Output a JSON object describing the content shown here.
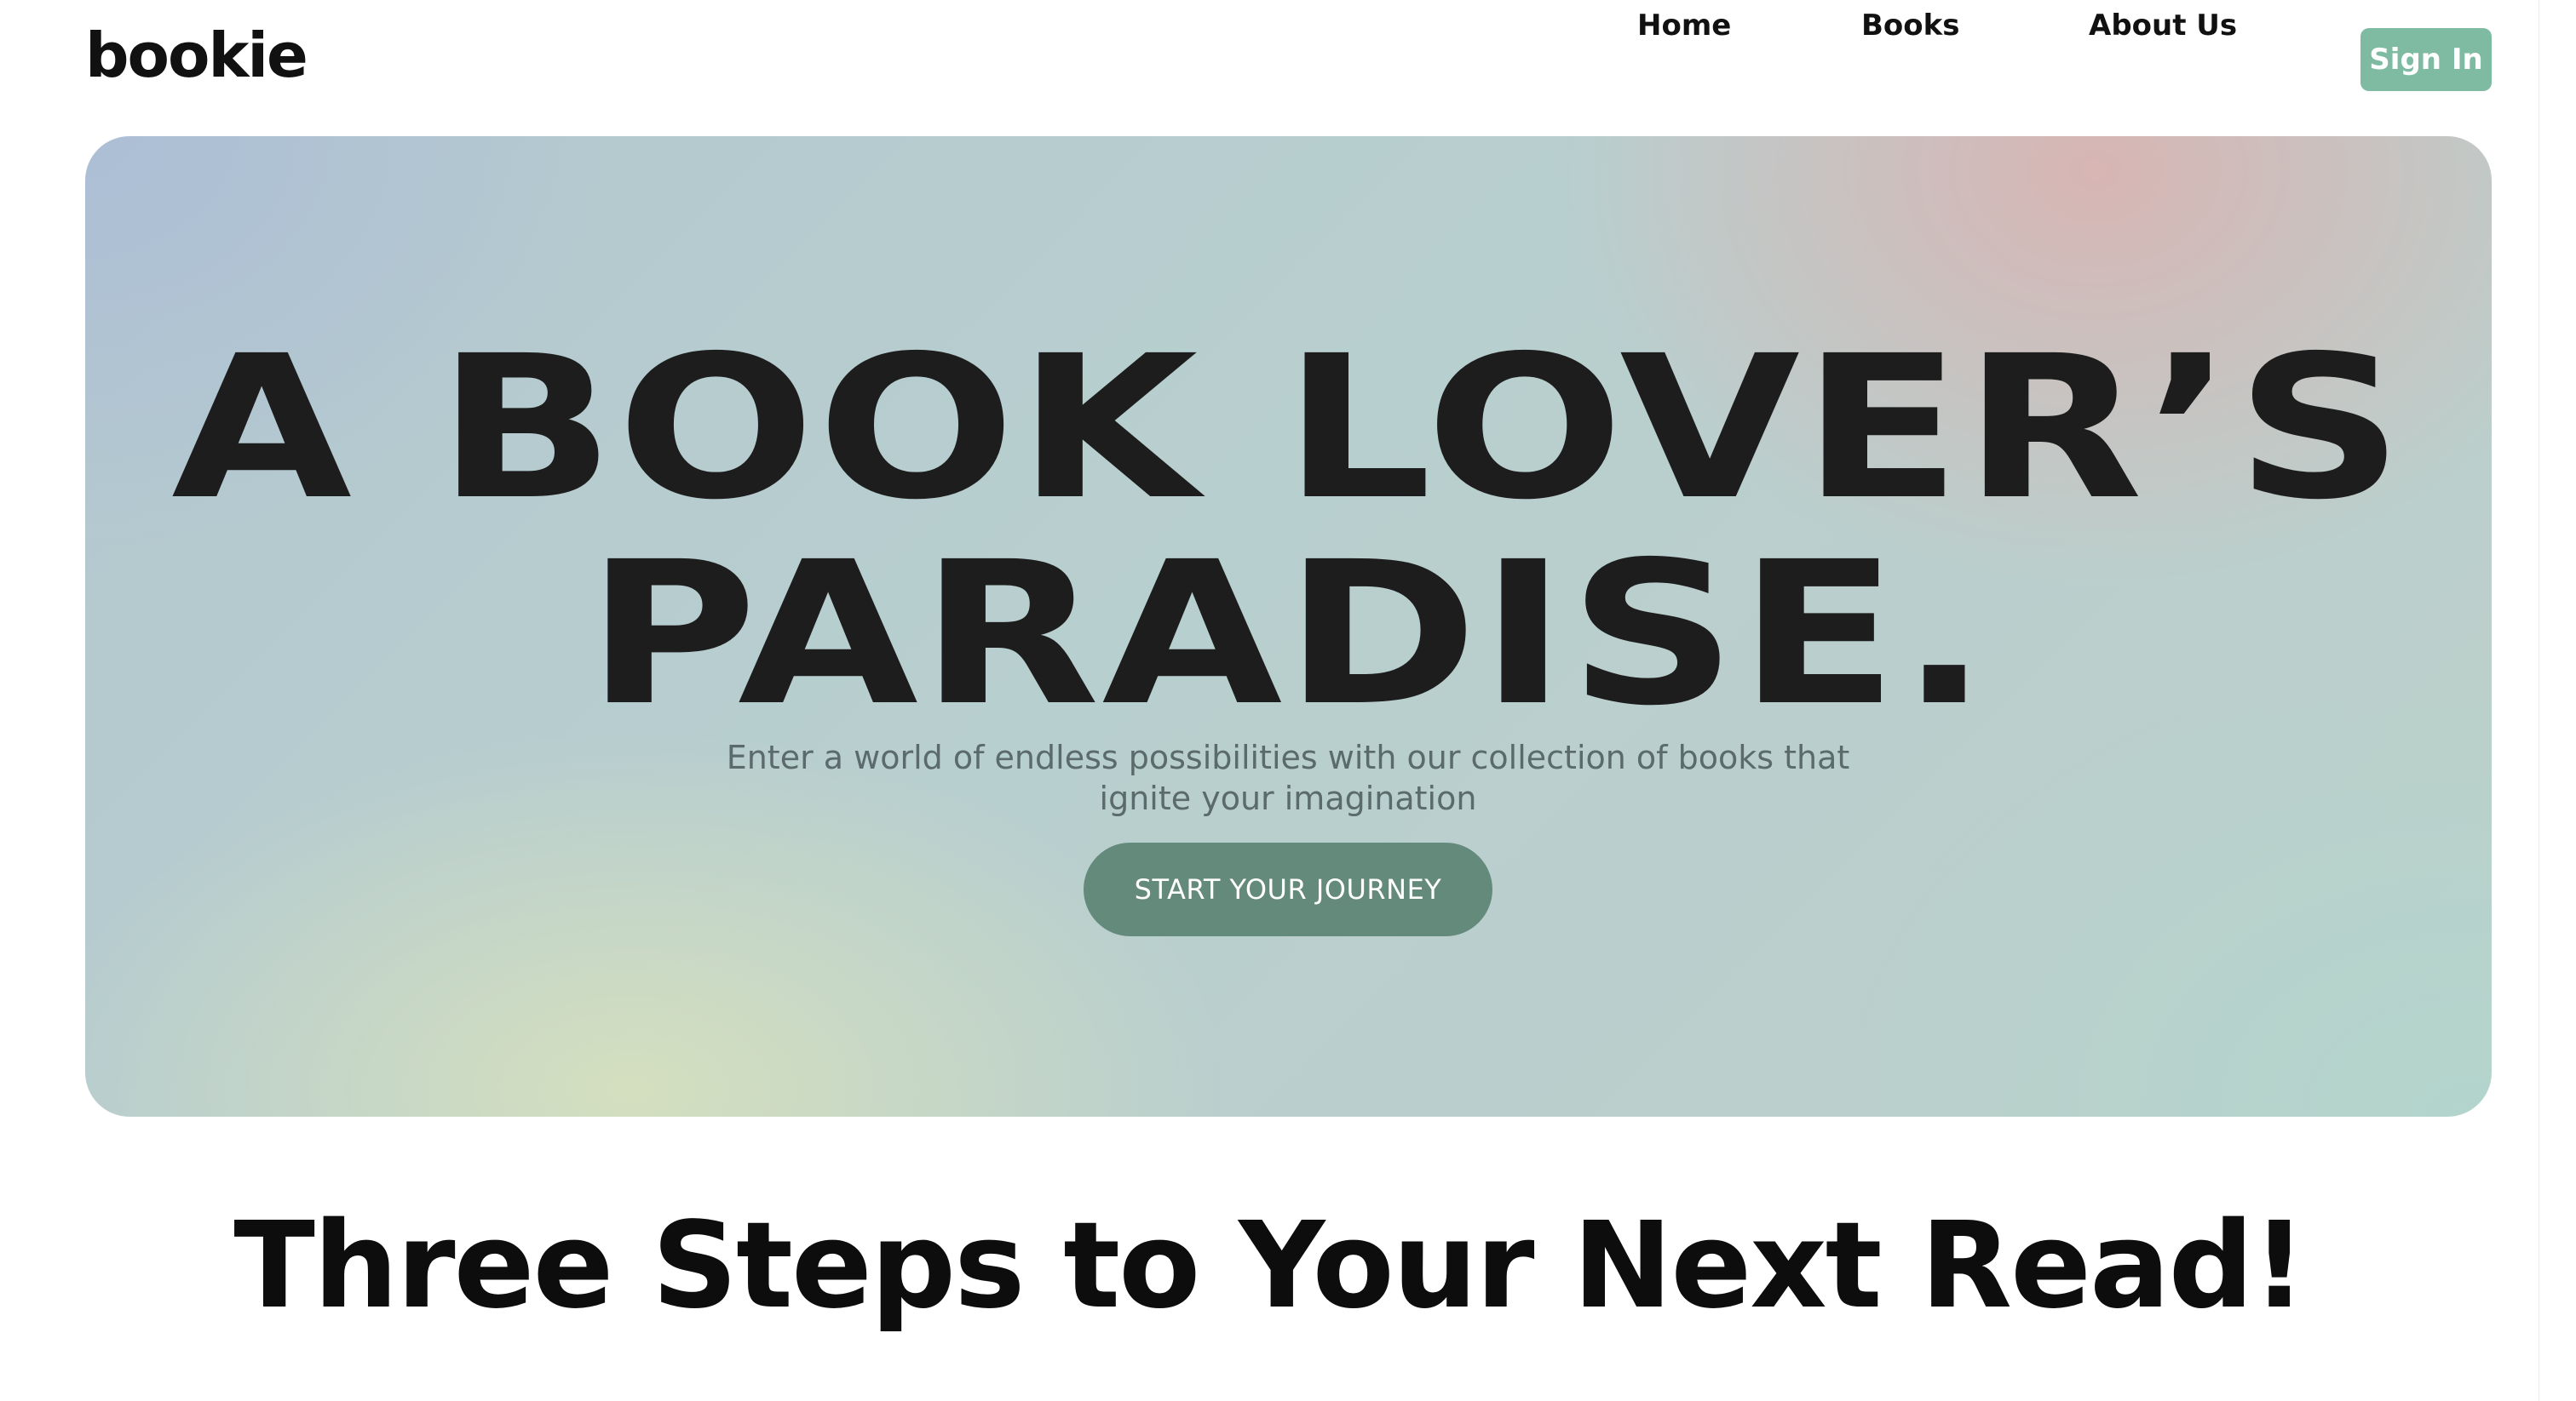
{
  "brand": {
    "logo_text": "bookie"
  },
  "nav": {
    "links": [
      {
        "label": "Home"
      },
      {
        "label": "Books"
      },
      {
        "label": "About Us"
      }
    ],
    "signin_label": "Sign In"
  },
  "hero": {
    "title_line1": "A BOOK LOVER’S",
    "title_line2": "PARADISE.",
    "subtitle": "Enter a world of endless possibilities with our collection of books that ignite your imagination",
    "cta_label": "START YOUR JOURNEY"
  },
  "section": {
    "title": "Three Steps to Your Next Read!"
  },
  "colors": {
    "accent": "#7fbba3",
    "cta": "#638a7b",
    "text": "#1d1d1d"
  }
}
